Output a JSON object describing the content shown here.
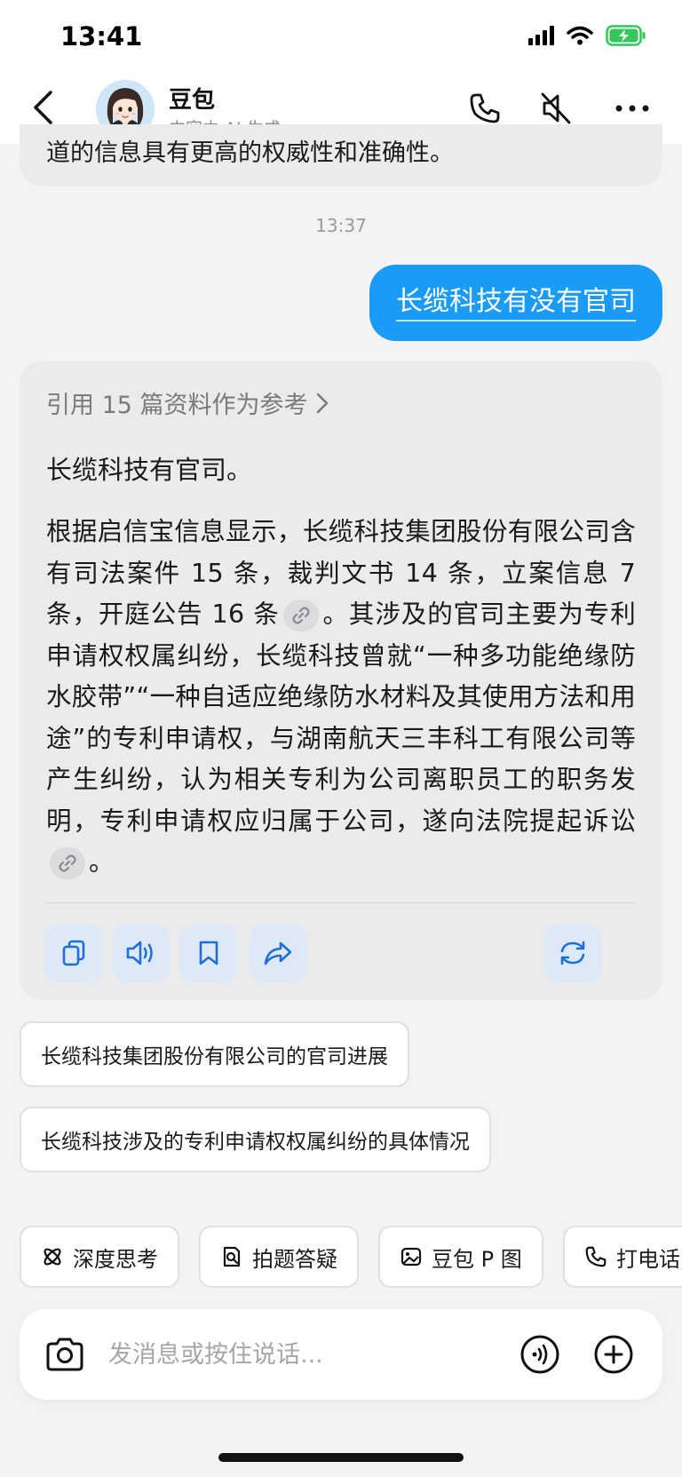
{
  "status": {
    "time": "13:41"
  },
  "header": {
    "name": "豆包",
    "subtitle": "内容由 AI 生成"
  },
  "chat": {
    "previous_fragment": "道的信息具有更高的权威性和准确性。",
    "timestamp": "13:37",
    "user_message": "长缆科技有没有官司",
    "answer": {
      "references": "引用 15 篇资料作为参考",
      "title": "长缆科技有官司。",
      "body_part1": "根据启信宝信息显示，长缆科技集团股份有限公司含有司法案件 15 条，裁判文书 14 条，立案信息 7 条，开庭公告 16 条",
      "body_part2": "。其涉及的官司主要为专利申请权权属纠纷，长缆科技曾就“一种多功能绝缘防水胶带”“一种自适应绝缘防水材料及其使用方法和用途”的专利申请权，与湖南航天三丰科工有限公司等产生纠纷，认为相关专利为公司离职员工的职务发明，专利申请权应归属于公司，遂向法院提起诉讼",
      "body_part3": "。"
    },
    "suggestions": [
      "长缆科技集团股份有限公司的官司进展",
      "长缆科技涉及的专利申请权权属纠纷的具体情况"
    ]
  },
  "tools": [
    "深度思考",
    "拍题答疑",
    "豆包 P 图",
    "打电话"
  ],
  "input": {
    "placeholder": "发消息或按住说话..."
  },
  "colors": {
    "accent": "#1a9bf5",
    "bubble_gray": "#ebebed",
    "action_bg": "#dde9f6",
    "battery": "#34c759"
  },
  "icons": [
    "back-icon",
    "phone-icon",
    "mute-icon",
    "more-icon",
    "chevron-right-icon",
    "link-icon",
    "copy-icon",
    "speaker-icon",
    "bookmark-icon",
    "share-icon",
    "regenerate-icon",
    "deep-think-icon",
    "photo-question-icon",
    "image-edit-icon",
    "camera-icon",
    "voice-icon",
    "plus-icon"
  ]
}
